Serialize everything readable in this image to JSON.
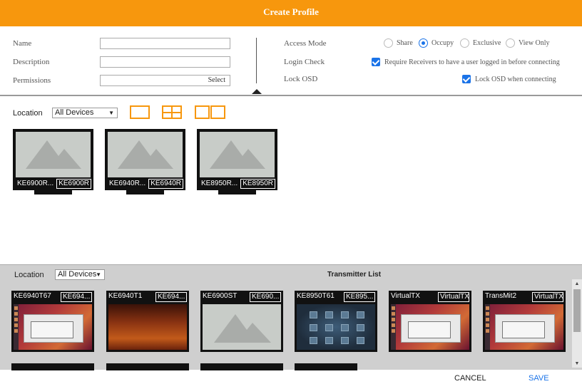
{
  "header": {
    "title": "Create Profile"
  },
  "form": {
    "name_label": "Name",
    "description_label": "Description",
    "permissions_label": "Permissions",
    "name_value": "",
    "description_value": "",
    "permissions_button": "Select",
    "access_mode_label": "Access Mode",
    "access_modes": [
      {
        "label": "Share",
        "selected": false
      },
      {
        "label": "Occupy",
        "selected": true
      },
      {
        "label": "Exclusive",
        "selected": false
      },
      {
        "label": "View Only",
        "selected": false
      }
    ],
    "login_check_label": "Login Check",
    "login_check_text": "Require Receivers to have a user logged in before connecting",
    "login_check_checked": true,
    "lock_osd_label": "Lock OSD",
    "lock_osd_text": "Lock OSD when connecting",
    "lock_osd_checked": true
  },
  "receivers": {
    "location_label": "Location",
    "location_value": "All Devices",
    "layout_icons": [
      "single-screen-icon",
      "quad-screen-icon",
      "dual-screen-icon"
    ],
    "items": [
      {
        "name": "KE6900R...",
        "tag": "KE6900R"
      },
      {
        "name": "KE6940R...",
        "tag": "KE6940R"
      },
      {
        "name": "KE8950R...",
        "tag": "KE8950R"
      }
    ]
  },
  "transmitters": {
    "location_label": "Location",
    "location_value": "All Devices",
    "title": "Transmitter List",
    "items": [
      {
        "name": "KE6940T67",
        "tag": "KE694...",
        "thumb": "desktop"
      },
      {
        "name": "KE6940T1",
        "tag": "KE694...",
        "thumb": "warm"
      },
      {
        "name": "KE6900ST",
        "tag": "KE690...",
        "thumb": "placeholder"
      },
      {
        "name": "KE8950T61",
        "tag": "KE895...",
        "thumb": "tiles"
      },
      {
        "name": "VirtualTX",
        "tag": "VirtualTX",
        "thumb": "desktop"
      },
      {
        "name": "TransMit2",
        "tag": "VirtualTX",
        "thumb": "desktop"
      }
    ]
  },
  "footer": {
    "cancel": "CANCEL",
    "save": "SAVE"
  },
  "colors": {
    "accent": "#f7970d",
    "blue": "#1a73e8"
  }
}
